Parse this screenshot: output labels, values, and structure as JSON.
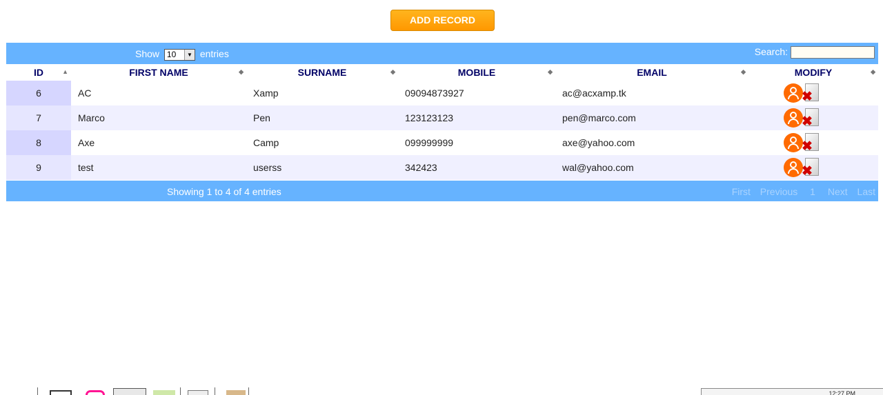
{
  "toolbar": {
    "add_label": "ADD RECORD"
  },
  "controls": {
    "show_label": "Show",
    "entries_value": "10",
    "entries_label": "entries",
    "search_label": "Search:",
    "search_value": ""
  },
  "table": {
    "headers": [
      "ID",
      "FIRST NAME",
      "SURNAME",
      "MOBILE",
      "EMAIL",
      "MODIFY"
    ],
    "rows": [
      {
        "id": "6",
        "first": "AC",
        "surname": "Xamp",
        "mobile": "09094873927",
        "email": "ac@acxamp.tk"
      },
      {
        "id": "7",
        "first": "Marco",
        "surname": "Pen",
        "mobile": "123123123",
        "email": "pen@marco.com"
      },
      {
        "id": "8",
        "first": "Axe",
        "surname": "Camp",
        "mobile": "099999999",
        "email": "axe@yahoo.com"
      },
      {
        "id": "9",
        "first": "test",
        "surname": "userss",
        "mobile": "342423",
        "email": "wal@yahoo.com"
      }
    ]
  },
  "footer": {
    "info": "Showing 1 to 4 of 4 entries",
    "first": "First",
    "previous": "Previous",
    "page": "1",
    "next": "Next",
    "last": "Last"
  },
  "taskbar": {
    "clock": "12:27 PM"
  },
  "colors": {
    "accent": "#66b3ff",
    "button": "#ff9800",
    "header_text": "#000066",
    "edit_icon": "#ff6a00"
  }
}
